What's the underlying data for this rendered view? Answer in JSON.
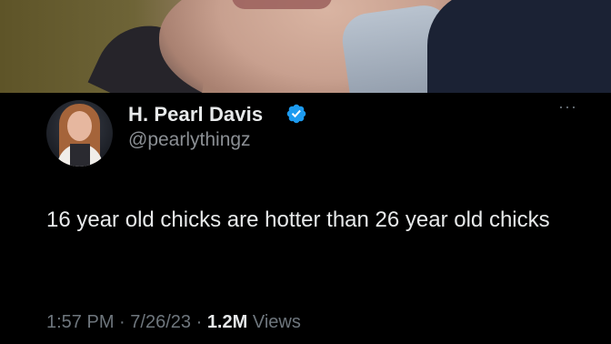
{
  "tweet": {
    "display_name": "H. Pearl Davis",
    "handle": "@pearlythingz",
    "text": "16 year old chicks are hotter than 26 year old chicks",
    "time": "1:57 PM",
    "date": "7/26/23",
    "views_count": "1.2M",
    "views_label": "Views",
    "separator": "·",
    "more_label": "···"
  },
  "colors": {
    "background": "#000000",
    "name_text": "#e7e9ea",
    "secondary_text": "#6e767d",
    "verified_badge": "#1d9bf0"
  },
  "icons": {
    "verified": "verified-badge-icon",
    "more": "more-options-icon"
  }
}
